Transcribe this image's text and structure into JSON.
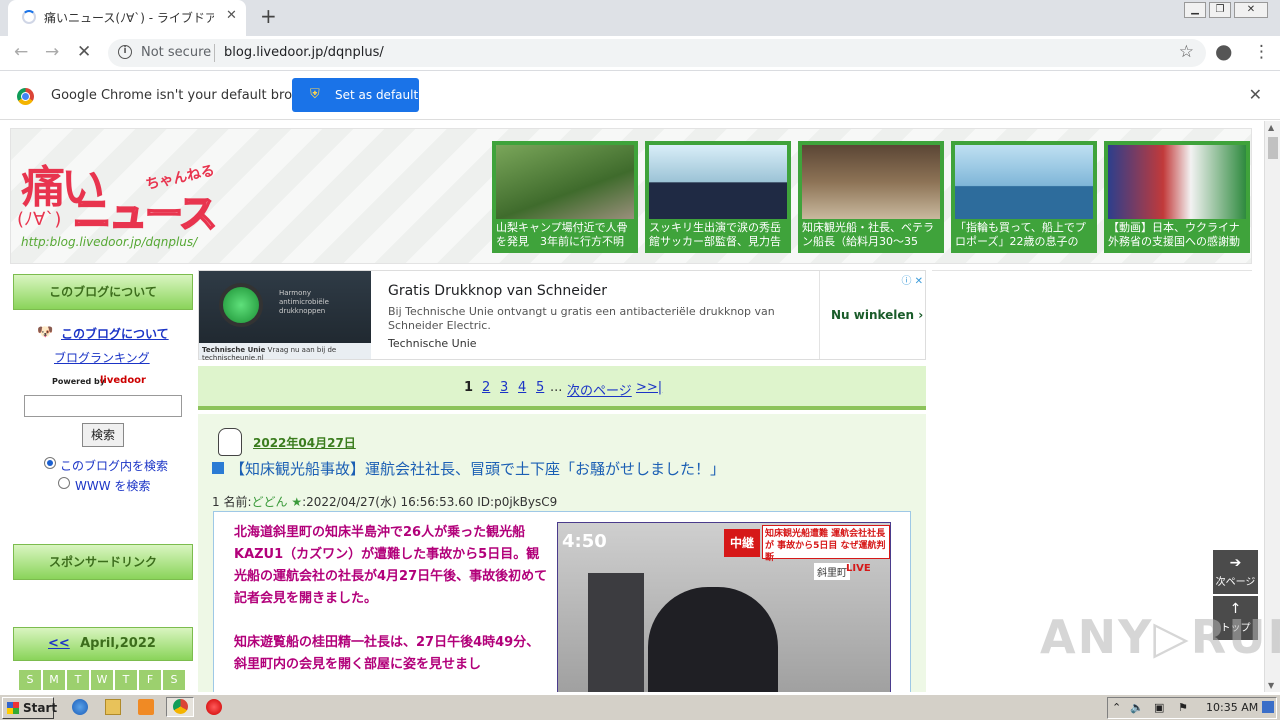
{
  "browser": {
    "tab_title": "痛いニュース(ﾉ∀`) - ライブドアブログ",
    "new_tab": "+",
    "security_label": "Not secure",
    "url": "blog.livedoor.jp/dqnplus/",
    "infobar_message": "Google Chrome isn't your default browser",
    "set_default_label": "Set as default"
  },
  "header": {
    "logo_main": "痛い",
    "logo_sub": "ニュース",
    "logo_chan": "ちゃんねる",
    "logo_face": "(ﾉ∀`)",
    "logo_url": "http:blog.livedoor.jp/dqnplus/",
    "thumbs": [
      {
        "caption": "山梨キャンプ場付近で人骨を発見　3年前に行方不明"
      },
      {
        "caption": "スッキリ生出演で涙の秀岳館サッカー部監督、見力告"
      },
      {
        "caption": "知床観光船・社長、ベテラン船長（給料月30〜35"
      },
      {
        "caption": "「指輪も買って、船上でプロポーズ」22歳の息子の"
      },
      {
        "caption": "【動画】日本、ウクライナ外務省の支援国への感謝動"
      }
    ]
  },
  "sidebar": {
    "about_header": "このブログについて",
    "about_link": "このブログについて",
    "ranking_link": "ブログランキング",
    "powered_by": "Powered by",
    "livedoor": "livedoor",
    "search_button": "検索",
    "radio_blog": "このブログ内を検索",
    "radio_www": "WWW を検索",
    "sponsor_header": "スポンサードリンク",
    "calendar_prev": "<<",
    "calendar_title": "April,2022",
    "calendar_days": [
      "S",
      "M",
      "T",
      "W",
      "T",
      "F",
      "S"
    ]
  },
  "ad": {
    "image_text": "Harmony antimicrobiële drukknoppen",
    "image_brand": "Technische Unie",
    "image_footer": "Vraag nu aan bij de technischeunie.nl",
    "headline": "Gratis Drukknop van Schneider",
    "description": "Bij Technische Unie ontvangt u gratis een antibacteriële drukknop van Schneider Electric.",
    "advertiser": "Technische Unie",
    "cta": "Nu winkelen",
    "adchoices": "ⓘ ✕"
  },
  "pager": {
    "current": "1",
    "pages": [
      "2",
      "3",
      "4",
      "5"
    ],
    "ellipsis": "...",
    "next": "次のページ",
    "last": ">>|"
  },
  "post": {
    "date": "2022年04月27日",
    "title": "【知床観光船事故】運航会社社長、冒頭で土下座「お騒がせしました！」",
    "meta_prefix": "1 名前:",
    "meta_name": "どどん ★",
    "meta_rest": ":2022/04/27(水) 16:56:53.60 ID:p0jkBysC9",
    "body_p1": "北海道斜里町の知床半島沖で26人が乗った観光船KAZU1（カズワン）が遭難した事故から5日目。観光船の運航会社の社長が4月27日午後、事故後初めて記者会見を開きました。",
    "body_p2": "知床遊覧船の桂田精一社長は、27日午後4時49分、斜里町内の会見を開く部屋に姿を見せまし",
    "photo_clock": "4:50",
    "photo_chuukei": "中継",
    "photo_banner": "知床観光船遭難 運航会社社長が 事故から5日目 なぜ運航判断",
    "photo_location": "斜里町",
    "photo_live": "LIVE"
  },
  "floating": {
    "next_page": "次ページ",
    "top": "トップ"
  },
  "watermark": "ANY▷RUN",
  "taskbar": {
    "start": "Start",
    "time": "10:35 AM"
  }
}
